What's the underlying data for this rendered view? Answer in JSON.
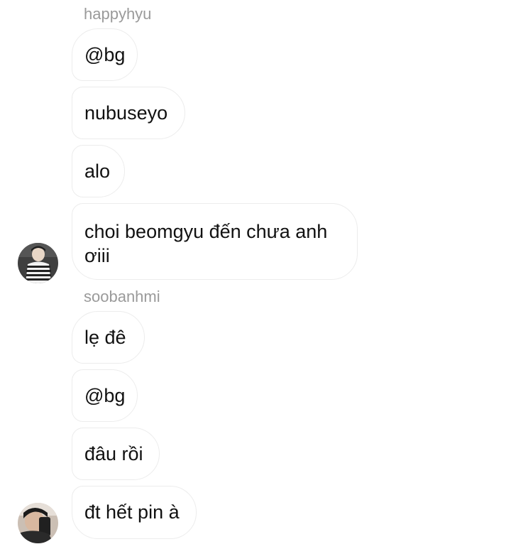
{
  "groups": [
    {
      "sender": "happyhyu",
      "messages": [
        "@bg",
        "nubuseyo",
        "alo",
        "choi beomgyu đến chưa anh ơiii"
      ],
      "avatar_icon": "user-avatar-striped-sweater-icon"
    },
    {
      "sender": "soobanhmi",
      "messages": [
        "lẹ đê",
        "@bg",
        "đâu rồi",
        "đt hết pin à"
      ],
      "avatar_icon": "user-avatar-phone-selfie-icon"
    }
  ],
  "colors": {
    "background": "#ffffff",
    "bubble_border": "#ececec",
    "sender_text": "#9a9a9a",
    "message_text": "#111111"
  }
}
